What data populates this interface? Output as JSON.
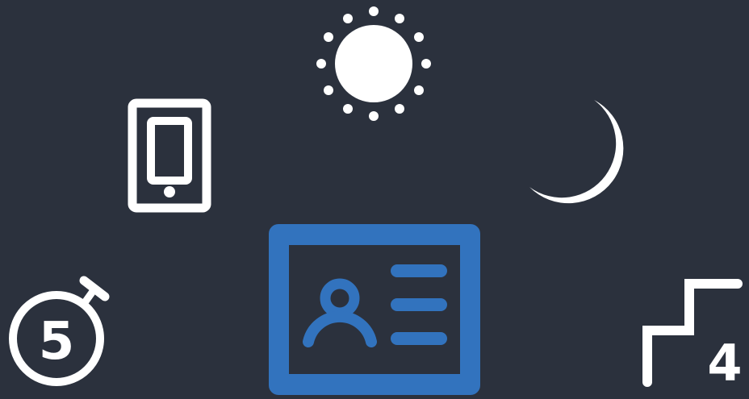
{
  "colors": {
    "background": "#2b313d",
    "white": "#ffffff",
    "accent_blue": "#3273be"
  },
  "icons": [
    {
      "name": "sun-icon"
    },
    {
      "name": "smartphone-icon"
    },
    {
      "name": "crescent-moon-icon"
    },
    {
      "name": "id-card-icon"
    },
    {
      "name": "timer-5-icon"
    },
    {
      "name": "stairs-4-icon"
    }
  ],
  "timer": {
    "number": "5"
  },
  "stairs": {
    "number": "4"
  }
}
